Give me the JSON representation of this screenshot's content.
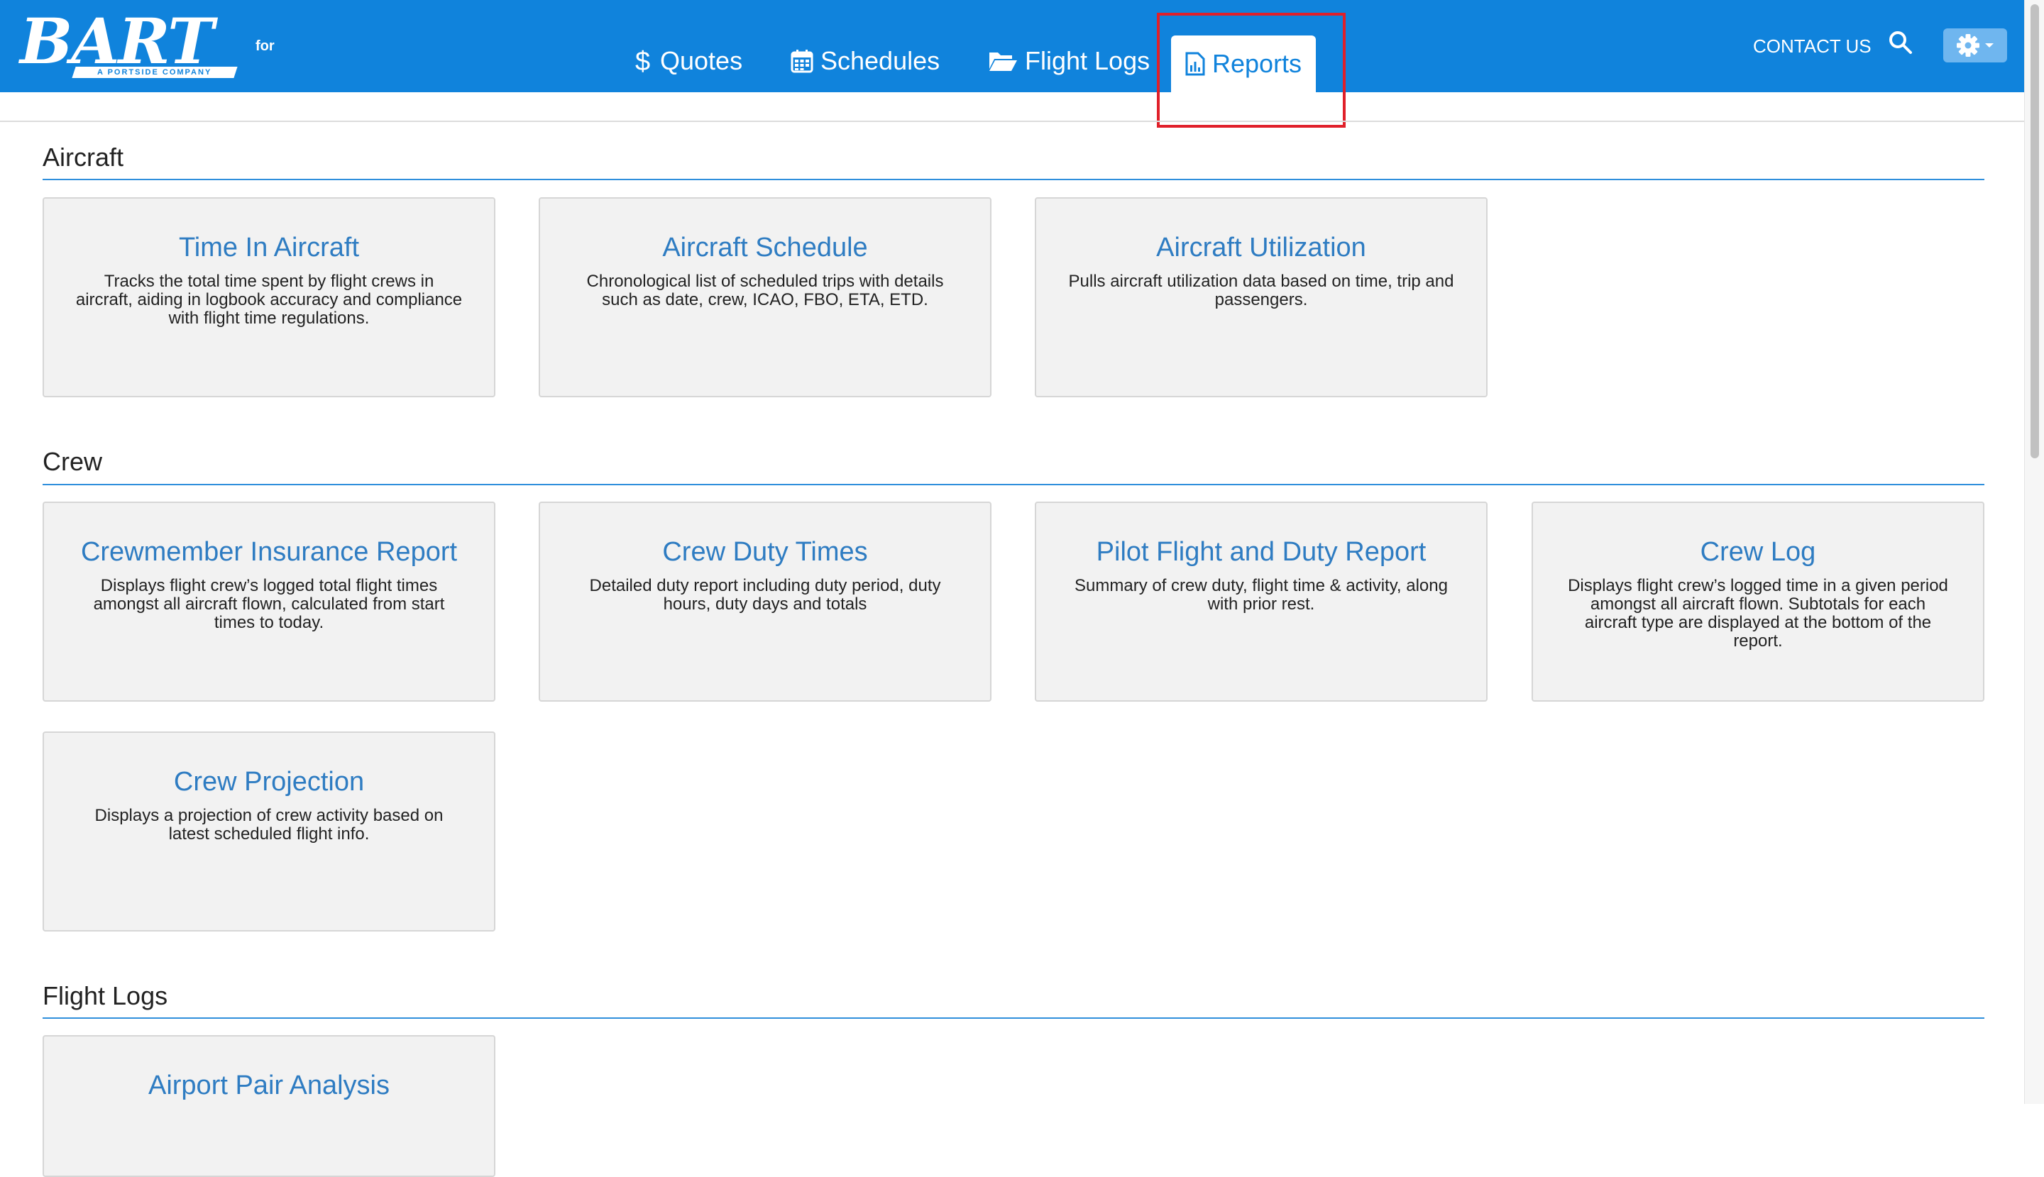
{
  "brand": {
    "name": "BART",
    "tagline": "A PORTSIDE COMPANY",
    "for_label": "for"
  },
  "nav": {
    "tabs": [
      {
        "label": "Quotes",
        "icon": "dollar-icon"
      },
      {
        "label": "Schedules",
        "icon": "calendar-icon"
      },
      {
        "label": "Flight Logs",
        "icon": "folder-open-icon"
      },
      {
        "label": "Reports",
        "icon": "report-icon",
        "active": true
      }
    ],
    "contact_label": "CONTACT US",
    "search_icon": "search-icon",
    "settings_icon": "gear-icon"
  },
  "colors": {
    "navbar": "#1083dc",
    "card_title": "#2e7cc2",
    "highlight": "#e0202a",
    "rule": "#2f8fdc"
  },
  "sections": [
    {
      "title": "Aircraft",
      "cards": [
        {
          "title": "Time In Aircraft",
          "desc_lines": [
            "Tracks the total time spent by flight crews in",
            "aircraft, aiding in logbook accuracy and compliance",
            "with flight time regulations."
          ]
        },
        {
          "title": "Aircraft Schedule",
          "desc_lines": [
            "Chronological list of scheduled trips with details",
            "such as date, crew, ICAO, FBO, ETA, ETD."
          ]
        },
        {
          "title": "Aircraft Utilization",
          "desc_lines": [
            "Pulls aircraft utilization data based on time, trip and",
            "passengers."
          ]
        }
      ]
    },
    {
      "title": "Crew",
      "cards": [
        {
          "title": "Crewmember Insurance Report",
          "desc_lines": [
            "Displays flight crew’s logged total flight times",
            "amongst all aircraft flown, calculated from start",
            "times to today."
          ]
        },
        {
          "title": "Crew Duty Times",
          "desc_lines": [
            "Detailed duty report including duty period, duty",
            "hours, duty days and totals"
          ]
        },
        {
          "title": "Pilot Flight and Duty Report",
          "desc_lines": [
            "Summary of crew duty, flight time & activity, along",
            "with prior rest."
          ]
        },
        {
          "title": "Crew Log",
          "desc_lines": [
            "Displays flight crew’s logged time in a given period",
            "amongst all aircraft flown. Subtotals for each",
            "aircraft type are displayed at the bottom of the",
            "report."
          ]
        },
        {
          "title": "Crew Projection",
          "desc_lines": [
            "Displays a projection of crew activity based on",
            "latest scheduled flight info."
          ]
        }
      ]
    },
    {
      "title": "Flight Logs",
      "cards": [
        {
          "title": "Airport Pair Analysis",
          "desc_lines": []
        }
      ]
    }
  ]
}
